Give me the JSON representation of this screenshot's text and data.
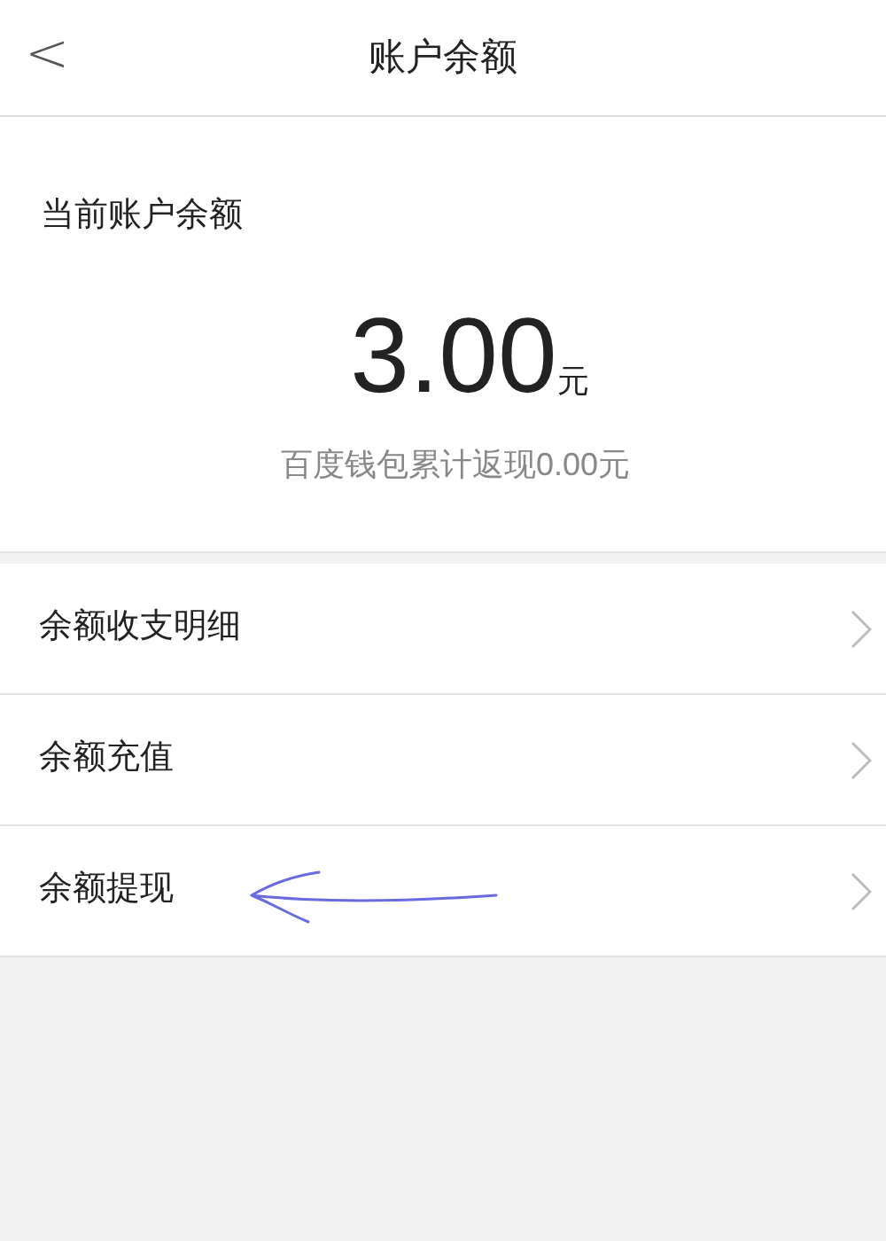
{
  "header": {
    "back": "<",
    "title": "账户余额"
  },
  "balance": {
    "label": "当前账户余额",
    "amount": "3.00",
    "unit": "元",
    "note": "百度钱包累计返现0.00元"
  },
  "menu": [
    {
      "label": "余额收支明细",
      "annotated": false
    },
    {
      "label": "余额充值",
      "annotated": false
    },
    {
      "label": "余额提现",
      "annotated": true
    }
  ]
}
